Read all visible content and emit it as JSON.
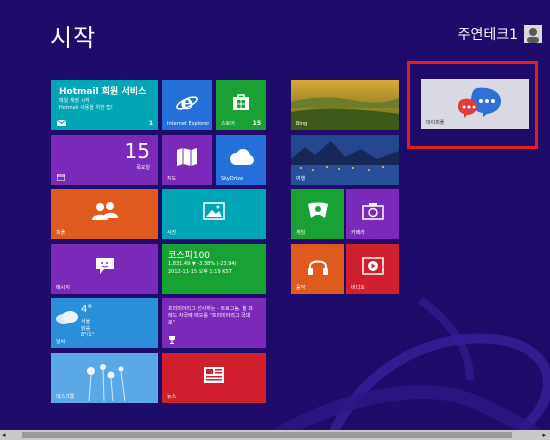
{
  "page": {
    "title": "시작"
  },
  "user": {
    "name": "주연테크1"
  },
  "tiles": {
    "hotmail": {
      "title": "Hotmail 회원 서비스",
      "line1": "메일 계정 시작",
      "line2": "Hotmail 사용을 위한 팁!",
      "badge": "1"
    },
    "ie": {
      "label": "Internet Explorer"
    },
    "store": {
      "label": "스토어",
      "badge": "15"
    },
    "calendar": {
      "day": "15",
      "weekday": "목요일"
    },
    "maps": {
      "label": "지도"
    },
    "skydrive": {
      "label": "SkyDrive"
    },
    "people": {
      "label": "피플"
    },
    "photos": {
      "label": "사진"
    },
    "messaging": {
      "label": "메시지"
    },
    "finance": {
      "title": "코스피100",
      "line1": "1,831.49  ▼ -3.38% (-23.94)",
      "line2": "2012-11-15  오후 1:19 KST"
    },
    "weather": {
      "temp": "4°",
      "line1": "서울",
      "line2": "맑음",
      "line3": "8°/1°",
      "label": "날씨"
    },
    "sports": {
      "text": "프리미어리그 선사하는 - 트로그놈. 윌 프레드 자국에 떠오를 \"프리미어리그 국대로\""
    },
    "desktop": {
      "label": "데스크톱"
    },
    "news": {
      "label": "뉴스"
    },
    "bing": {
      "label": "Bing"
    },
    "travel": {
      "label": "여행"
    },
    "games": {
      "label": "게임"
    },
    "camera": {
      "label": "카메라"
    },
    "music": {
      "label": "음악"
    },
    "video": {
      "label": "비디오"
    },
    "mypeople": {
      "label": "마이피플"
    }
  },
  "colors": {
    "background": "#1f0b6a",
    "teal": "#00a5b6",
    "blue": "#2470d8",
    "green": "#1aa133",
    "purple": "#7b29b8",
    "orange": "#de5a1f",
    "red": "#d0202d",
    "highlight": "#e01e25"
  },
  "icons": [
    "mail-icon",
    "ie-icon",
    "store-icon",
    "calendar-icon",
    "maps-icon",
    "cloud-icon",
    "people-icon",
    "photo-icon",
    "chat-icon",
    "weather-icon",
    "trophy-icon",
    "news-icon",
    "gamepad-icon",
    "camera-icon",
    "headphones-icon",
    "play-icon",
    "mypeople-icon",
    "user-icon"
  ]
}
